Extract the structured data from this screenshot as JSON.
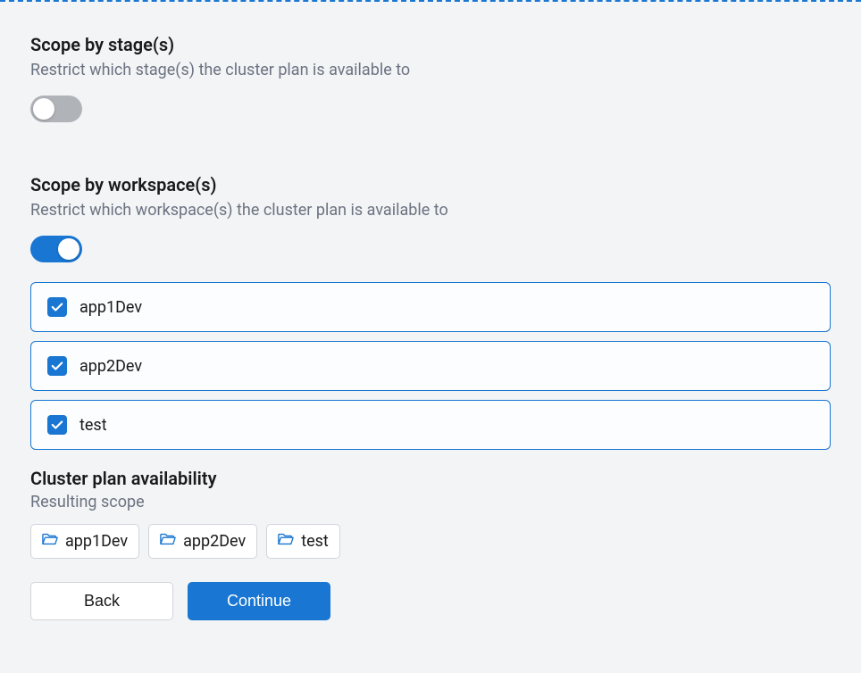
{
  "stages": {
    "title": "Scope by stage(s)",
    "description": "Restrict which stage(s) the cluster plan is available to",
    "enabled": false
  },
  "workspaces": {
    "title": "Scope by workspace(s)",
    "description": "Restrict which workspace(s) the cluster plan is available to",
    "enabled": true,
    "items": [
      {
        "label": "app1Dev",
        "checked": true
      },
      {
        "label": "app2Dev",
        "checked": true
      },
      {
        "label": "test",
        "checked": true
      }
    ]
  },
  "availability": {
    "title": "Cluster plan availability",
    "subtitle": "Resulting scope",
    "tags": [
      {
        "label": "app1Dev"
      },
      {
        "label": "app2Dev"
      },
      {
        "label": "test"
      }
    ]
  },
  "buttons": {
    "back": "Back",
    "continue": "Continue"
  }
}
